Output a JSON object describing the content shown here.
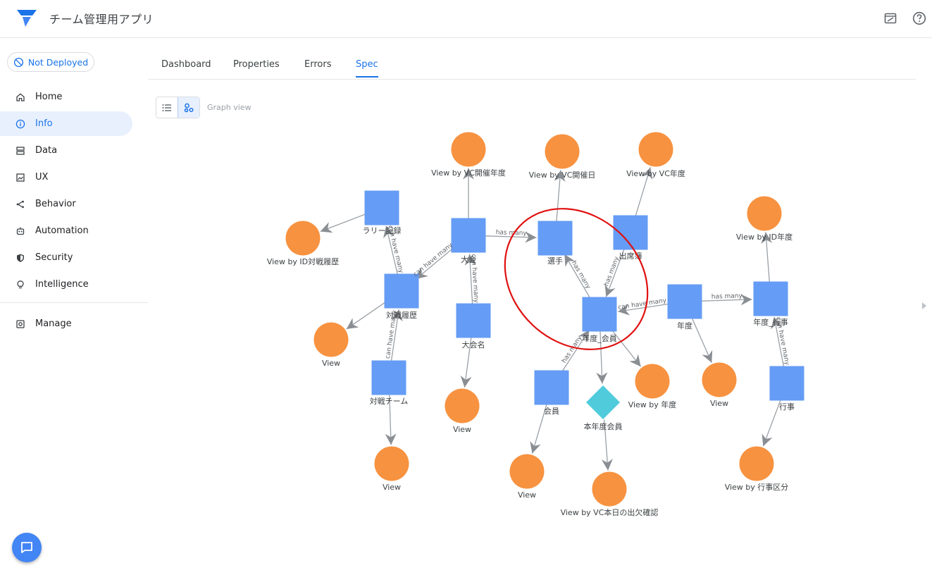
{
  "app": {
    "title": "チーム管理用アプリ"
  },
  "deploy": {
    "status": "Not Deployed"
  },
  "nav": {
    "items": [
      {
        "label": "Home"
      },
      {
        "label": "Info"
      },
      {
        "label": "Data"
      },
      {
        "label": "UX"
      },
      {
        "label": "Behavior"
      },
      {
        "label": "Automation"
      },
      {
        "label": "Security"
      },
      {
        "label": "Intelligence"
      }
    ],
    "manage": "Manage"
  },
  "tabs": [
    "Dashboard",
    "Properties",
    "Errors",
    "Spec"
  ],
  "view": {
    "label": "Graph view"
  },
  "graph": {
    "nodes": [
      {
        "label": "View by VC開催年度"
      },
      {
        "label": "View by VC開催日"
      },
      {
        "label": "View by VC年度"
      },
      {
        "label": "ラリー記録"
      },
      {
        "label": "大会"
      },
      {
        "label": "選手"
      },
      {
        "label": "出席簿"
      },
      {
        "label": "View by ID年度"
      },
      {
        "label": "View by ID対戦履歴"
      },
      {
        "label": "対戦履歴"
      },
      {
        "label": "大会名"
      },
      {
        "label": "年度_会員"
      },
      {
        "label": "年度"
      },
      {
        "label": "年度_行事"
      },
      {
        "label": "View"
      },
      {
        "label": "対戦チーム"
      },
      {
        "label": "会員"
      },
      {
        "label": "本年度会員"
      },
      {
        "label": "View by 年度"
      },
      {
        "label": "View"
      },
      {
        "label": "行事"
      },
      {
        "label": "View"
      },
      {
        "label": "View"
      },
      {
        "label": "View"
      },
      {
        "label": "View by VC本日の出欠確認"
      },
      {
        "label": "View by 行事区分"
      }
    ],
    "edges": [
      {
        "label": "has many"
      },
      {
        "label": "can have many"
      },
      {
        "label": "can have many"
      },
      {
        "label": "can have many"
      },
      {
        "label": "can have many"
      },
      {
        "label": "has many"
      },
      {
        "label": "has many"
      },
      {
        "label": "has many"
      },
      {
        "label": "can have many"
      },
      {
        "label": "has many"
      },
      {
        "label": "can have many"
      }
    ]
  },
  "colors": {
    "accent": "#1a73e8",
    "table_node": "#659cf5",
    "view_node": "#f79240",
    "slice_node": "#50cbdc",
    "highlight_ellipse": "#e01010",
    "edge": "#9aa0a6"
  }
}
